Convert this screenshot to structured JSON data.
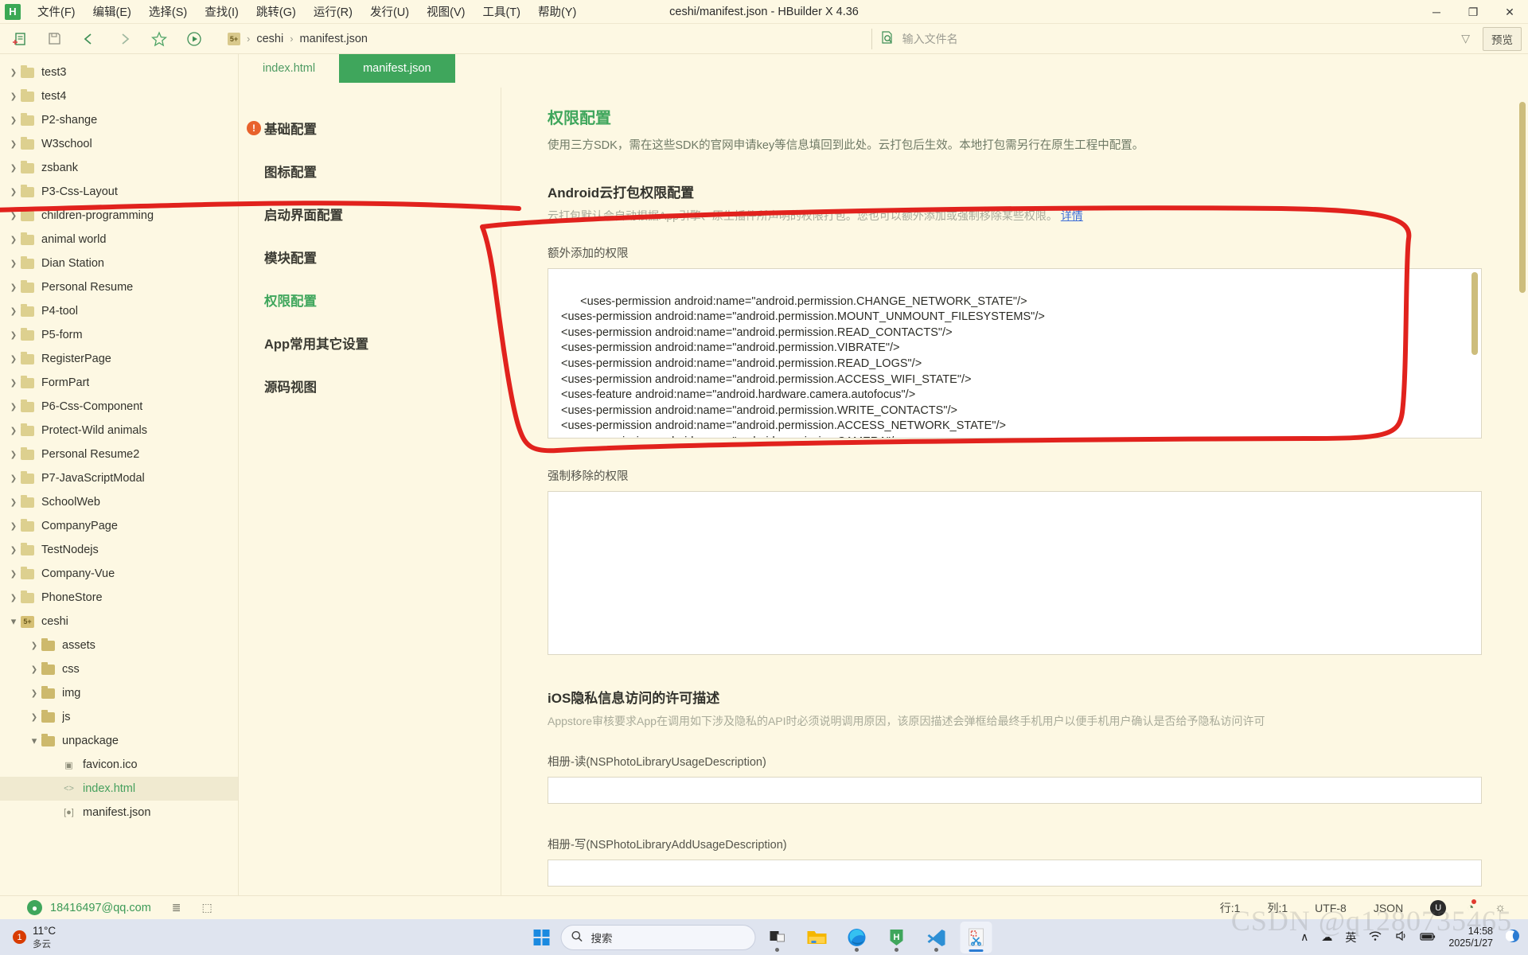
{
  "window": {
    "title": "ceshi/manifest.json - HBuilder X 4.36",
    "logo_letter": "H",
    "minimize": "─",
    "maximize": "❐",
    "close": "✕"
  },
  "menu": [
    {
      "label": "文件(F)"
    },
    {
      "label": "编辑(E)"
    },
    {
      "label": "选择(S)"
    },
    {
      "label": "查找(I)"
    },
    {
      "label": "跳转(G)"
    },
    {
      "label": "运行(R)"
    },
    {
      "label": "发行(U)"
    },
    {
      "label": "视图(V)"
    },
    {
      "label": "工具(T)"
    },
    {
      "label": "帮助(Y)"
    }
  ],
  "toolbar": {
    "new_icon": "➕",
    "save_icon": "὚B",
    "back_icon": "‹",
    "forward_icon": "›",
    "star_icon": "☆",
    "run_icon": "▶",
    "breadcrumb": {
      "project_badge": "5+",
      "items": [
        "ceshi",
        "manifest.json"
      ],
      "separator": "›"
    },
    "search_placeholder": "输入文件名",
    "search_icon": "search-file-icon",
    "funnel_icon": "▽",
    "preview_label": "预览"
  },
  "sidebar": {
    "tree": [
      {
        "label": "test3",
        "type": "folder",
        "state": "closed",
        "depth": 0
      },
      {
        "label": "test4",
        "type": "folder",
        "state": "closed",
        "depth": 0
      },
      {
        "label": "P2-shange",
        "type": "folder",
        "state": "closed",
        "depth": 0
      },
      {
        "label": "W3school",
        "type": "folder",
        "state": "closed",
        "depth": 0
      },
      {
        "label": "zsbank",
        "type": "folder",
        "state": "closed",
        "depth": 0
      },
      {
        "label": "P3-Css-Layout",
        "type": "folder",
        "state": "closed",
        "depth": 0
      },
      {
        "label": "children-programming",
        "type": "folder",
        "state": "closed",
        "depth": 0
      },
      {
        "label": "animal world",
        "type": "folder",
        "state": "closed",
        "depth": 0
      },
      {
        "label": "Dian Station",
        "type": "folder",
        "state": "closed",
        "depth": 0
      },
      {
        "label": "Personal Resume",
        "type": "folder",
        "state": "closed",
        "depth": 0
      },
      {
        "label": "P4-tool",
        "type": "folder",
        "state": "closed",
        "depth": 0
      },
      {
        "label": "P5-form",
        "type": "folder",
        "state": "closed",
        "depth": 0
      },
      {
        "label": "RegisterPage",
        "type": "folder",
        "state": "closed",
        "depth": 0
      },
      {
        "label": "FormPart",
        "type": "folder",
        "state": "closed",
        "depth": 0
      },
      {
        "label": "P6-Css-Component",
        "type": "folder",
        "state": "closed",
        "depth": 0
      },
      {
        "label": "Protect-Wild animals",
        "type": "folder",
        "state": "closed",
        "depth": 0
      },
      {
        "label": "Personal Resume2",
        "type": "folder",
        "state": "closed",
        "depth": 0
      },
      {
        "label": "P7-JavaScriptModal",
        "type": "folder",
        "state": "closed",
        "depth": 0
      },
      {
        "label": "SchoolWeb",
        "type": "folder",
        "state": "closed",
        "depth": 0
      },
      {
        "label": "CompanyPage",
        "type": "folder",
        "state": "closed",
        "depth": 0
      },
      {
        "label": "TestNodejs",
        "type": "folder",
        "state": "closed",
        "depth": 0
      },
      {
        "label": "Company-Vue",
        "type": "folder",
        "state": "closed",
        "depth": 0
      },
      {
        "label": "PhoneStore",
        "type": "folder",
        "state": "closed",
        "depth": 0
      },
      {
        "label": "ceshi",
        "type": "project",
        "state": "open",
        "depth": 0,
        "badge": "5+"
      },
      {
        "label": "assets",
        "type": "folder",
        "state": "closed",
        "depth": 1
      },
      {
        "label": "css",
        "type": "folder",
        "state": "closed",
        "depth": 1
      },
      {
        "label": "img",
        "type": "folder",
        "state": "closed",
        "depth": 1
      },
      {
        "label": "js",
        "type": "folder",
        "state": "closed",
        "depth": 1
      },
      {
        "label": "unpackage",
        "type": "folder",
        "state": "open",
        "depth": 1
      },
      {
        "label": "favicon.ico",
        "type": "image-file",
        "state": "none",
        "depth": 2,
        "icon": "▣"
      },
      {
        "label": "index.html",
        "type": "code-file",
        "state": "none",
        "depth": 2,
        "icon": "<>",
        "selected": true
      },
      {
        "label": "manifest.json",
        "type": "json-file",
        "state": "none",
        "depth": 2,
        "icon": "[●]"
      }
    ],
    "bottom_icons": [
      {
        "name": "explorer-icon",
        "glyph": "▤"
      },
      {
        "name": "binoculars-icon",
        "glyph": "◎◎"
      },
      {
        "name": "bug-icon",
        "glyph": "☣"
      },
      {
        "name": "terminal-icon",
        "glyph": "⥁"
      },
      {
        "name": "cloud-icon",
        "glyph": "☁"
      }
    ]
  },
  "editor_tabs": [
    {
      "label": "index.html",
      "active": false
    },
    {
      "label": "manifest.json",
      "active": true
    }
  ],
  "manifest_nav": [
    {
      "label": "基础配置",
      "active": false,
      "warning": true,
      "warning_glyph": "!"
    },
    {
      "label": "图标配置",
      "active": false,
      "warning": false
    },
    {
      "label": "启动界面配置",
      "active": false,
      "warning": false
    },
    {
      "label": "模块配置",
      "active": false,
      "warning": false
    },
    {
      "label": "权限配置",
      "active": true,
      "warning": false
    },
    {
      "label": "App常用其它设置",
      "active": false,
      "warning": false
    },
    {
      "label": "源码视图",
      "active": false,
      "warning": false
    }
  ],
  "main": {
    "section_title": "权限配置",
    "section_desc": "使用三方SDK，需在这些SDK的官网申请key等信息填回到此处。云打包后生效。本地打包需另行在原生工程中配置。",
    "android_title": "Android云打包权限配置",
    "android_desc": "云打包默认会自动根据App引擎、原生插件所声明的权限打包。您也可以额外添加或强制移除某些权限。",
    "android_desc_link": "详情",
    "extra_perm_label": "额外添加的权限",
    "extra_perm_value": "<uses-permission android:name=\"android.permission.CHANGE_NETWORK_STATE\"/>\n<uses-permission android:name=\"android.permission.MOUNT_UNMOUNT_FILESYSTEMS\"/>\n<uses-permission android:name=\"android.permission.READ_CONTACTS\"/>\n<uses-permission android:name=\"android.permission.VIBRATE\"/>\n<uses-permission android:name=\"android.permission.READ_LOGS\"/>\n<uses-permission android:name=\"android.permission.ACCESS_WIFI_STATE\"/>\n<uses-feature android:name=\"android.hardware.camera.autofocus\"/>\n<uses-permission android:name=\"android.permission.WRITE_CONTACTS\"/>\n<uses-permission android:name=\"android.permission.ACCESS_NETWORK_STATE\"/>\n<uses-permission android:name=\"android.permission.CAMERA\"/>\n<uses-permission android:name=\"android.permission.RECORD_AUDIO\"/>",
    "remove_perm_label": "强制移除的权限",
    "remove_perm_value": "",
    "ios_title": "iOS隐私信息访问的许可描述",
    "ios_desc": "Appstore审核要求App在调用如下涉及隐私的API时必须说明调用原因，该原因描述会弹框给最终手机用户以便手机用户确认是否给予隐私访问许可",
    "ios_photo_read_label": "相册-读(NSPhotoLibraryUsageDescription)",
    "ios_photo_read_value": "",
    "ios_photo_write_label": "相册-写(NSPhotoLibraryAddUsageDescription)",
    "ios_photo_write_value": ""
  },
  "statusbar": {
    "account": "18416497@qq.com",
    "list_icon": "≣",
    "terminal_icon": "⬚",
    "line": "行:1",
    "column": "列:1",
    "encoding": "UTF-8",
    "language": "JSON",
    "badge_letter": "U",
    "clock_icon": "◔",
    "bell_icon": "🔔"
  },
  "taskbar": {
    "weather_badge": "1",
    "weather_temp": "11°C",
    "weather_sub": "多云",
    "search_placeholder": "搜索",
    "search_icon": "⚲",
    "apps": [
      {
        "name": "task-view",
        "glyph": "◰"
      },
      {
        "name": "file-explorer",
        "glyph": "🗀"
      },
      {
        "name": "microsoft-edge",
        "glyph": "e"
      },
      {
        "name": "hbuilderx",
        "glyph": "H"
      },
      {
        "name": "vs-code",
        "glyph": "✖"
      },
      {
        "name": "snipping-tool",
        "glyph": "✂"
      }
    ],
    "tray_up": "∧",
    "tray_cloud": "☁",
    "tray_ime": "英",
    "tray_wifi": "◔",
    "tray_volume": "♪",
    "tray_battery": "▬",
    "clock_time": "14:58",
    "clock_date": "2025/1/27"
  },
  "watermark": "CSDN @q1280735465"
}
